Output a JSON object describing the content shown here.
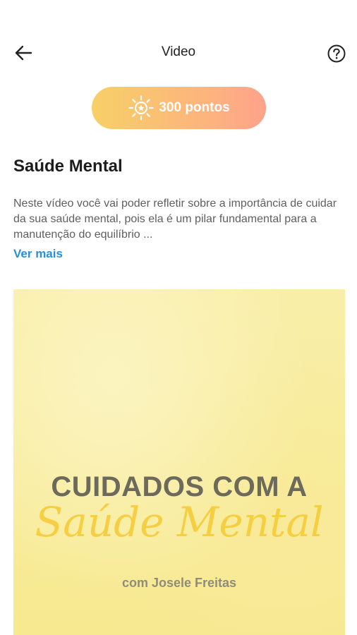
{
  "header": {
    "title": "Video",
    "back_icon": "arrow-left-icon",
    "help_icon": "question-circle-icon"
  },
  "points": {
    "label": "300 pontos",
    "icon": "sun-icon",
    "colors": [
      "#f7d067",
      "#fda28a"
    ]
  },
  "content": {
    "title": "Saúde Mental",
    "description": "Neste vídeo você vai poder refletir sobre a importância de cuidar da sua saúde mental, pois ela é um pilar fundamental para a manutenção do equilíbrio ...",
    "see_more": "Ver mais"
  },
  "video": {
    "heading": "CUIDADOS COM A",
    "script_title": "Saúde Mental",
    "author": "com Josele Freitas"
  },
  "colors": {
    "link": "#2a8fd8",
    "thumbnail_bg": "#f8ec9e",
    "script_text": "#f6cd3e"
  }
}
